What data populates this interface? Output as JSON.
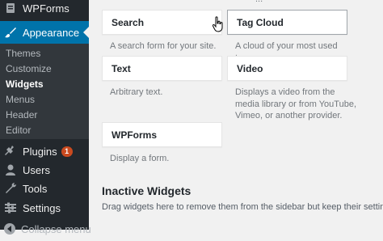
{
  "sidebar": {
    "wpforms_label": "WPForms",
    "appearance_label": "Appearance",
    "submenu": [
      "Themes",
      "Customize",
      "Widgets",
      "Menus",
      "Header",
      "Editor"
    ],
    "plugins_label": "Plugins",
    "plugins_badge": "1",
    "users_label": "Users",
    "tools_label": "Tools",
    "settings_label": "Settings",
    "collapse_label": "Collapse menu"
  },
  "widgets": {
    "top_cut": "...",
    "search": {
      "title": "Search",
      "desc": "A search form for your site."
    },
    "tag_cloud": {
      "title": "Tag Cloud",
      "desc": "A cloud of your most used tags."
    },
    "text": {
      "title": "Text",
      "desc": "Arbitrary text."
    },
    "video": {
      "title": "Video",
      "desc": "Displays a video from the media library or from YouTube, Vimeo, or another provider."
    },
    "wpforms": {
      "title": "WPForms",
      "desc": "Display a form."
    }
  },
  "inactive": {
    "title": "Inactive Widgets",
    "desc": "Drag widgets here to remove them from the sidebar but keep their settings."
  },
  "colors": {
    "sidebar_bg": "#23282d",
    "submenu_bg": "#32373c",
    "accent": "#0073aa",
    "badge": "#ca4a1f",
    "page_bg": "#f1f1f1"
  }
}
